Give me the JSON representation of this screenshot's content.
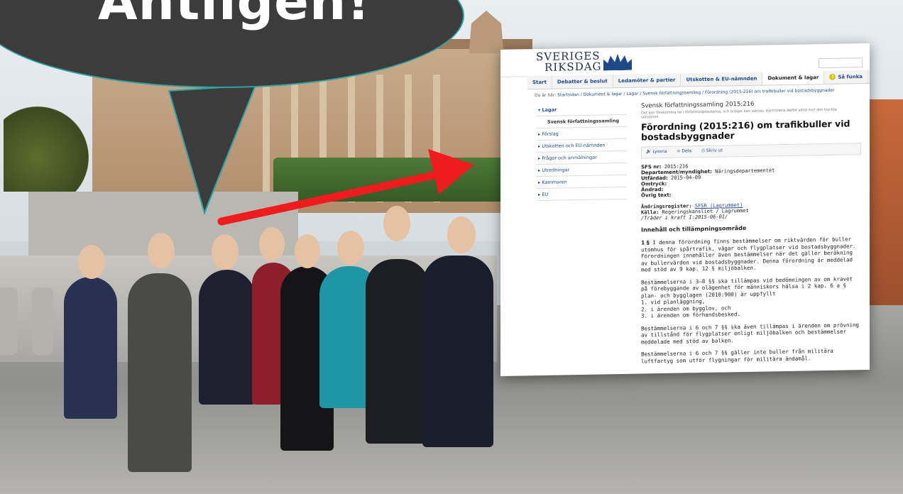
{
  "bubble": {
    "text": "Äntligen!"
  },
  "riksdag": {
    "logo_line1": "SVERIGES",
    "logo_line2": "RIKSDAG",
    "nav": [
      "Start",
      "Debatter & beslut",
      "Ledamöter & partier",
      "Utskotten & EU-nämnden",
      "Dokument & lagar"
    ],
    "nav_help": "Så funka",
    "breadcrumb_prefix": "Du är här:",
    "breadcrumb_path": "Startsidan / Dokument & lagar / Lagar / Svensk författningssamling / Förordning (2015:216) om trafikbuller vid bostadsbyggnader",
    "sidebar": [
      "Lagar",
      "Svensk författningssamling",
      "Förslag",
      "Utskotten och EU-nämnden",
      "Frågor och anmälningar",
      "Utredningar",
      "Kammaren",
      "EU"
    ],
    "doc": {
      "series": "Svensk författningssamling 2015:216",
      "note": "Det kan förekomma fel i författningstexterna, och bilagor kan saknas. Kontrollera därför alltid mot den tryckta versionen.",
      "title": "Förordning (2015:216) om trafikbuller vid bostadsbyggnader",
      "tools": [
        "Lyssna",
        "Dela",
        "Skriv ut"
      ],
      "meta": [
        {
          "label": "SFS nr:",
          "value": "2015:216"
        },
        {
          "label": "Departement/myndighet:",
          "value": "Näringsdepartementet"
        },
        {
          "label": "Utfärdad:",
          "value": "2015-04-09"
        },
        {
          "label": "Omtryck:",
          "value": ""
        },
        {
          "label": "Ändrad:",
          "value": ""
        },
        {
          "label": "Övrig text:",
          "value": ""
        }
      ],
      "register_label": "Ändringsregister:",
      "register_link": "SFSR (Lagrummet)",
      "source_label": "Källa:",
      "source_value": "Regeringskansliet / Lagrummet",
      "in_force": "/Träder i kraft I:2015-06-01/",
      "section_heading": "Innehåll och tillämpningsområde",
      "para1_num": "1 §",
      "para1": "I denna förordning finns bestämmelser om riktvärden för buller utomhus för spårtrafik, vägar och flygplatser vid bostadsbyggnader. Förordningen innehåller även bestämmelser när det gäller beräkning av bullervärden vid bostadsbyggnader. Denna förordning är meddelad med stöd av 9 kap. 12 § miljöbalken.",
      "para2": "Bestämmelserna i 3–8 §§ ska tillämpas vid bedömningen av om kravet på förebyggande av olägenhet för människors hälsa i 2 kap. 6 a § plan- och bygglagen (2010:900) är uppfyllt",
      "list": [
        "1. vid planläggning,",
        "2. i ärenden om bygglov, och",
        "3. i ärenden om förhandsbesked."
      ],
      "para3": "Bestämmelserna i 6 och 7 §§ ska även tillämpas i ärenden om prövning av tillstånd för flygplatser enligt miljöbalken och bestämmelser meddelade med stöd av balken.",
      "para4": "Bestämmelserna i 6 och 7 §§ gäller inte buller från militära luftfartyg som utför flygningar för militära ändamål."
    }
  }
}
